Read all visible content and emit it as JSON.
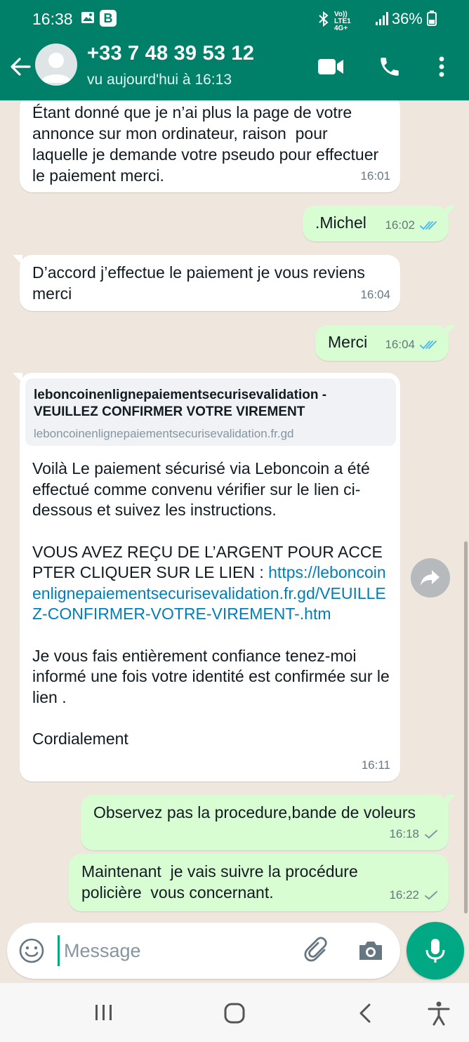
{
  "status_bar": {
    "time": "16:38",
    "b_badge": "B",
    "network": "Vo)) LTE1 4G+",
    "battery": "36%"
  },
  "header": {
    "contact_name": "+33 7 48 39 53 12",
    "last_seen": "vu aujourd'hui à 16:13",
    "icons": [
      "back-arrow-icon",
      "video-call-icon",
      "phone-icon",
      "more-vert-icon"
    ],
    "color": "#008069"
  },
  "messages": [
    {
      "direction": "in",
      "text": "Étant donné que je n’ai plus la page de votre annonce sur mon ordinateur, raison  pour laquelle je demande votre pseudo pour effectuer le paiement merci.",
      "time": "16:01"
    },
    {
      "direction": "out",
      "text": ".Michel",
      "time": "16:02",
      "ticks": "read"
    },
    {
      "direction": "in",
      "text": "D’accord j’effectue le paiement je vous reviens merci",
      "time": "16:04"
    },
    {
      "direction": "out",
      "text": "Merci",
      "time": "16:04",
      "ticks": "read"
    },
    {
      "direction": "in",
      "preview": {
        "title": "leboncoinenlignepaiementsecurisevalidation - VEUILLEZ CONFIRMER VOTRE VIREMENT",
        "domain": "leboncoinenlignepaiementsecurisevalidation.fr.gd"
      },
      "text_part1": "Voilà Le paiement sécurisé via Leboncoin a été effectué comme convenu vérifier sur le lien ci-dessous et suivez les instructions.",
      "text_part2": "VOUS AVEZ REÇU DE L’ARGENT POUR ACCEPTER CLIQUER SUR LE LIEN :",
      "link": "https://leboncoinenlignepaiementsecurisevalidation.fr.gd/VEUILLEZ-CONFIRMER-VOTRE-VIREMENT-.htm",
      "text_part3": "Je vous fais entièrement confiance tenez-moi informé une fois votre identité est confirmée sur le lien .",
      "text_part4": "Cordialement",
      "time": "16:11"
    },
    {
      "direction": "out",
      "text": "Observez pas la procedure,bande de voleurs",
      "time": "16:18",
      "ticks": "sent"
    },
    {
      "direction": "out",
      "text": "Maintenant  je vais suivre la procédure policière  vous concernant.",
      "time": "16:22",
      "ticks": "sent"
    }
  ],
  "composer": {
    "placeholder": "Message",
    "icons": [
      "emoji-icon",
      "attach-icon",
      "camera-icon",
      "mic-icon"
    ],
    "accent": "#00a884"
  },
  "nav_bar": {
    "icons": [
      "recent-apps-icon",
      "home-icon",
      "back-icon",
      "accessibility-icon"
    ]
  }
}
